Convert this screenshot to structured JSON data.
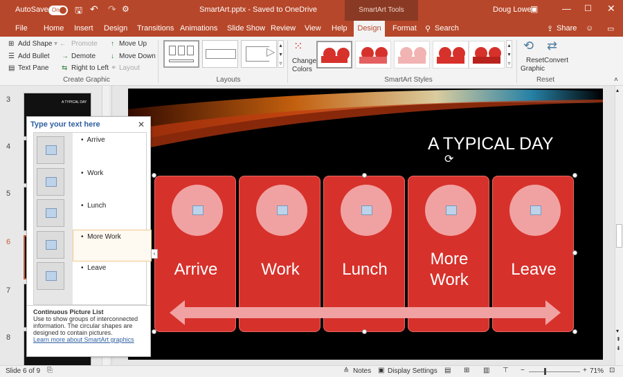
{
  "titlebar": {
    "autosave": "AutoSave",
    "autosave_state": "On",
    "doc_title": "SmartArt.pptx - Saved to OneDrive",
    "context_tools": "SmartArt Tools",
    "user": "Doug Lowe"
  },
  "tabs": [
    "File",
    "Home",
    "Insert",
    "Design",
    "Transitions",
    "Animations",
    "Slide Show",
    "Review",
    "View",
    "Help"
  ],
  "context_tabs": {
    "design": "Design",
    "format": "Format"
  },
  "search_label": "Search",
  "share_label": "Share",
  "ribbon": {
    "create_graphic": {
      "add_shape": "Add Shape",
      "promote": "Promote",
      "move_up": "Move Up",
      "add_bullet": "Add Bullet",
      "demote": "Demote",
      "move_down": "Move Down",
      "text_pane": "Text Pane",
      "right_to_left": "Right to Left",
      "layout": "Layout",
      "group_label": "Create Graphic"
    },
    "layouts_label": "Layouts",
    "change_colors": "Change\nColors",
    "change_colors_l1": "Change",
    "change_colors_l2": "Colors",
    "styles_label": "SmartArt Styles",
    "reset_graphic_l1": "Reset",
    "reset_graphic_l2": "Graphic",
    "convert": "Convert",
    "reset_group": "Reset"
  },
  "thumbnails": [
    "3",
    "4",
    "5",
    "6",
    "7",
    "8"
  ],
  "thumb3_text": "A TYPICAL DAY",
  "textpane": {
    "title": "Type your text here",
    "items": [
      "Arrive",
      "Work",
      "Lunch",
      "More Work",
      "Leave"
    ],
    "desc_title": "Continuous Picture List",
    "desc_body": "Use to show groups of interconnected information. The circular shapes are designed to contain pictures.",
    "link": "Learn more about SmartArt graphics"
  },
  "slide": {
    "title": "A TYPICAL DAY",
    "cards": [
      "Arrive",
      "Work",
      "Lunch",
      "More\nWork",
      "Leave"
    ],
    "card4_l1": "More",
    "card4_l2": "Work"
  },
  "status": {
    "slide_info": "Slide 6 of 9",
    "notes": "Notes",
    "display_settings": "Display Settings",
    "zoom": "71%"
  },
  "colors": {
    "brand": "#b7472a",
    "card": "#d7312b",
    "circle": "#f0a2a2"
  }
}
